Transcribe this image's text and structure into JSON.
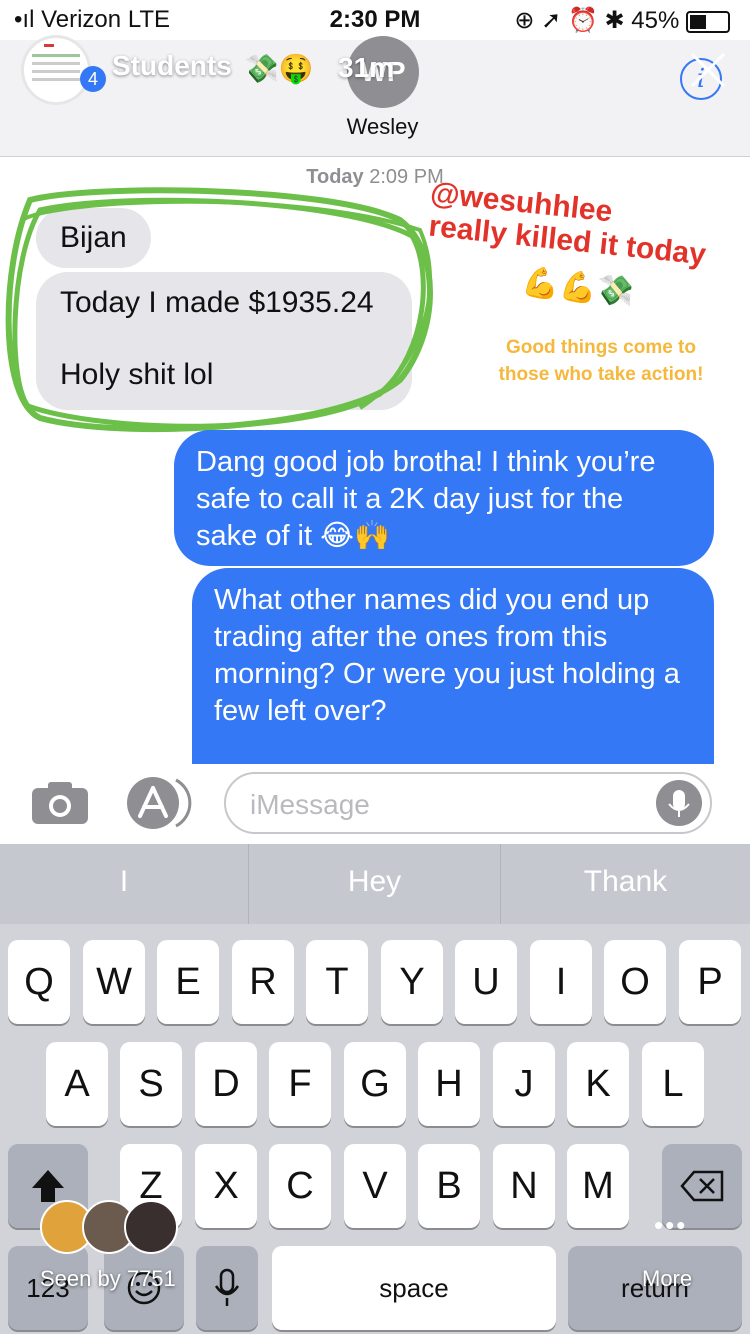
{
  "status_bar": {
    "carrier": "Verizon",
    "network": "LTE",
    "time": "2:30 PM",
    "battery": "45%"
  },
  "story": {
    "title": "Students",
    "count": "4",
    "emoji": "💸🤑",
    "time": "31m",
    "seen_by": "Seen by 7751",
    "more_label": "More"
  },
  "header": {
    "contact_initials": "WP",
    "contact_name": "Wesley",
    "info_label": "i"
  },
  "thread": {
    "timestamp_day": "Today",
    "timestamp_time": "2:09 PM",
    "messages": [
      {
        "from": "them",
        "text": "Bijan"
      },
      {
        "from": "them",
        "line1": "Today I made $1935.24",
        "line2": "Holy shit lol"
      },
      {
        "from": "me",
        "text": "Dang good job brotha! I think you’re safe to call it a 2K day just for the sake of it 😂🙌"
      },
      {
        "from": "me",
        "text": "What other names did you end up trading after the ones from this morning? Or were you just holding a few left over?"
      }
    ]
  },
  "overlay": {
    "handle": "@wesuhhlee",
    "caption": "really killed it today",
    "emoji": "💪💪💸",
    "quote_line1": "Good things come to",
    "quote_line2": "those who take action!",
    "highlight_color": "#6cc04a"
  },
  "input": {
    "placeholder": "iMessage"
  },
  "keyboard": {
    "suggestions": [
      "I",
      "Hey",
      "Thank"
    ],
    "row1": [
      "Q",
      "W",
      "E",
      "R",
      "T",
      "Y",
      "U",
      "I",
      "O",
      "P"
    ],
    "row2": [
      "A",
      "S",
      "D",
      "F",
      "G",
      "H",
      "J",
      "K",
      "L"
    ],
    "row3": [
      "Z",
      "X",
      "C",
      "V",
      "B",
      "N",
      "M"
    ],
    "numbers_label": "123",
    "space_label": "space",
    "return_label": "return"
  },
  "colors": {
    "imessage_blue": "#3478f6",
    "incoming_gray": "#e5e5ea",
    "overlay_red": "#e2332a",
    "overlay_gold": "#f5b83d"
  }
}
